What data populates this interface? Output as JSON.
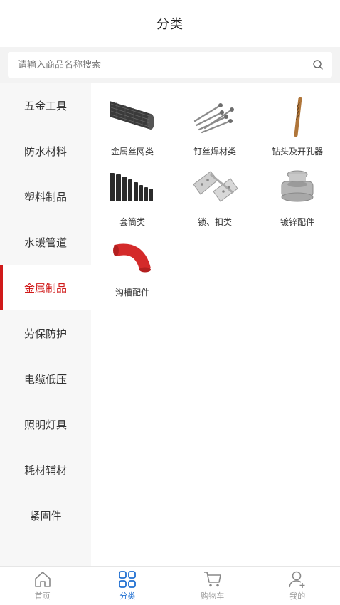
{
  "header": {
    "title": "分类"
  },
  "search": {
    "placeholder": "请输入商品名称搜索"
  },
  "sidebar": {
    "items": [
      {
        "label": "五金工具"
      },
      {
        "label": "防水材料"
      },
      {
        "label": "塑料制品"
      },
      {
        "label": "水暖管道"
      },
      {
        "label": "金属制品",
        "active": true
      },
      {
        "label": "劳保防护"
      },
      {
        "label": "电缆低压"
      },
      {
        "label": "照明灯具"
      },
      {
        "label": "耗材辅材"
      },
      {
        "label": "紧固件"
      }
    ]
  },
  "categories": [
    {
      "label": "金属丝网类",
      "icon": "wire-mesh-roll-icon"
    },
    {
      "label": "钉丝焊材类",
      "icon": "nails-icon"
    },
    {
      "label": "钻头及开孔器",
      "icon": "drill-bit-icon"
    },
    {
      "label": "套筒类",
      "icon": "socket-set-icon"
    },
    {
      "label": "锁、扣类",
      "icon": "hinge-icon"
    },
    {
      "label": "镀锌配件",
      "icon": "galvanized-fitting-icon"
    },
    {
      "label": "沟槽配件",
      "icon": "groove-elbow-icon"
    }
  ],
  "tabbar": {
    "items": [
      {
        "label": "首页",
        "icon": "home-icon"
      },
      {
        "label": "分类",
        "icon": "grid-icon",
        "active": true
      },
      {
        "label": "购物车",
        "icon": "cart-icon"
      },
      {
        "label": "我的",
        "icon": "user-icon"
      }
    ]
  },
  "colors": {
    "accent_red": "#d01a1a",
    "accent_blue": "#1f6fd1"
  }
}
